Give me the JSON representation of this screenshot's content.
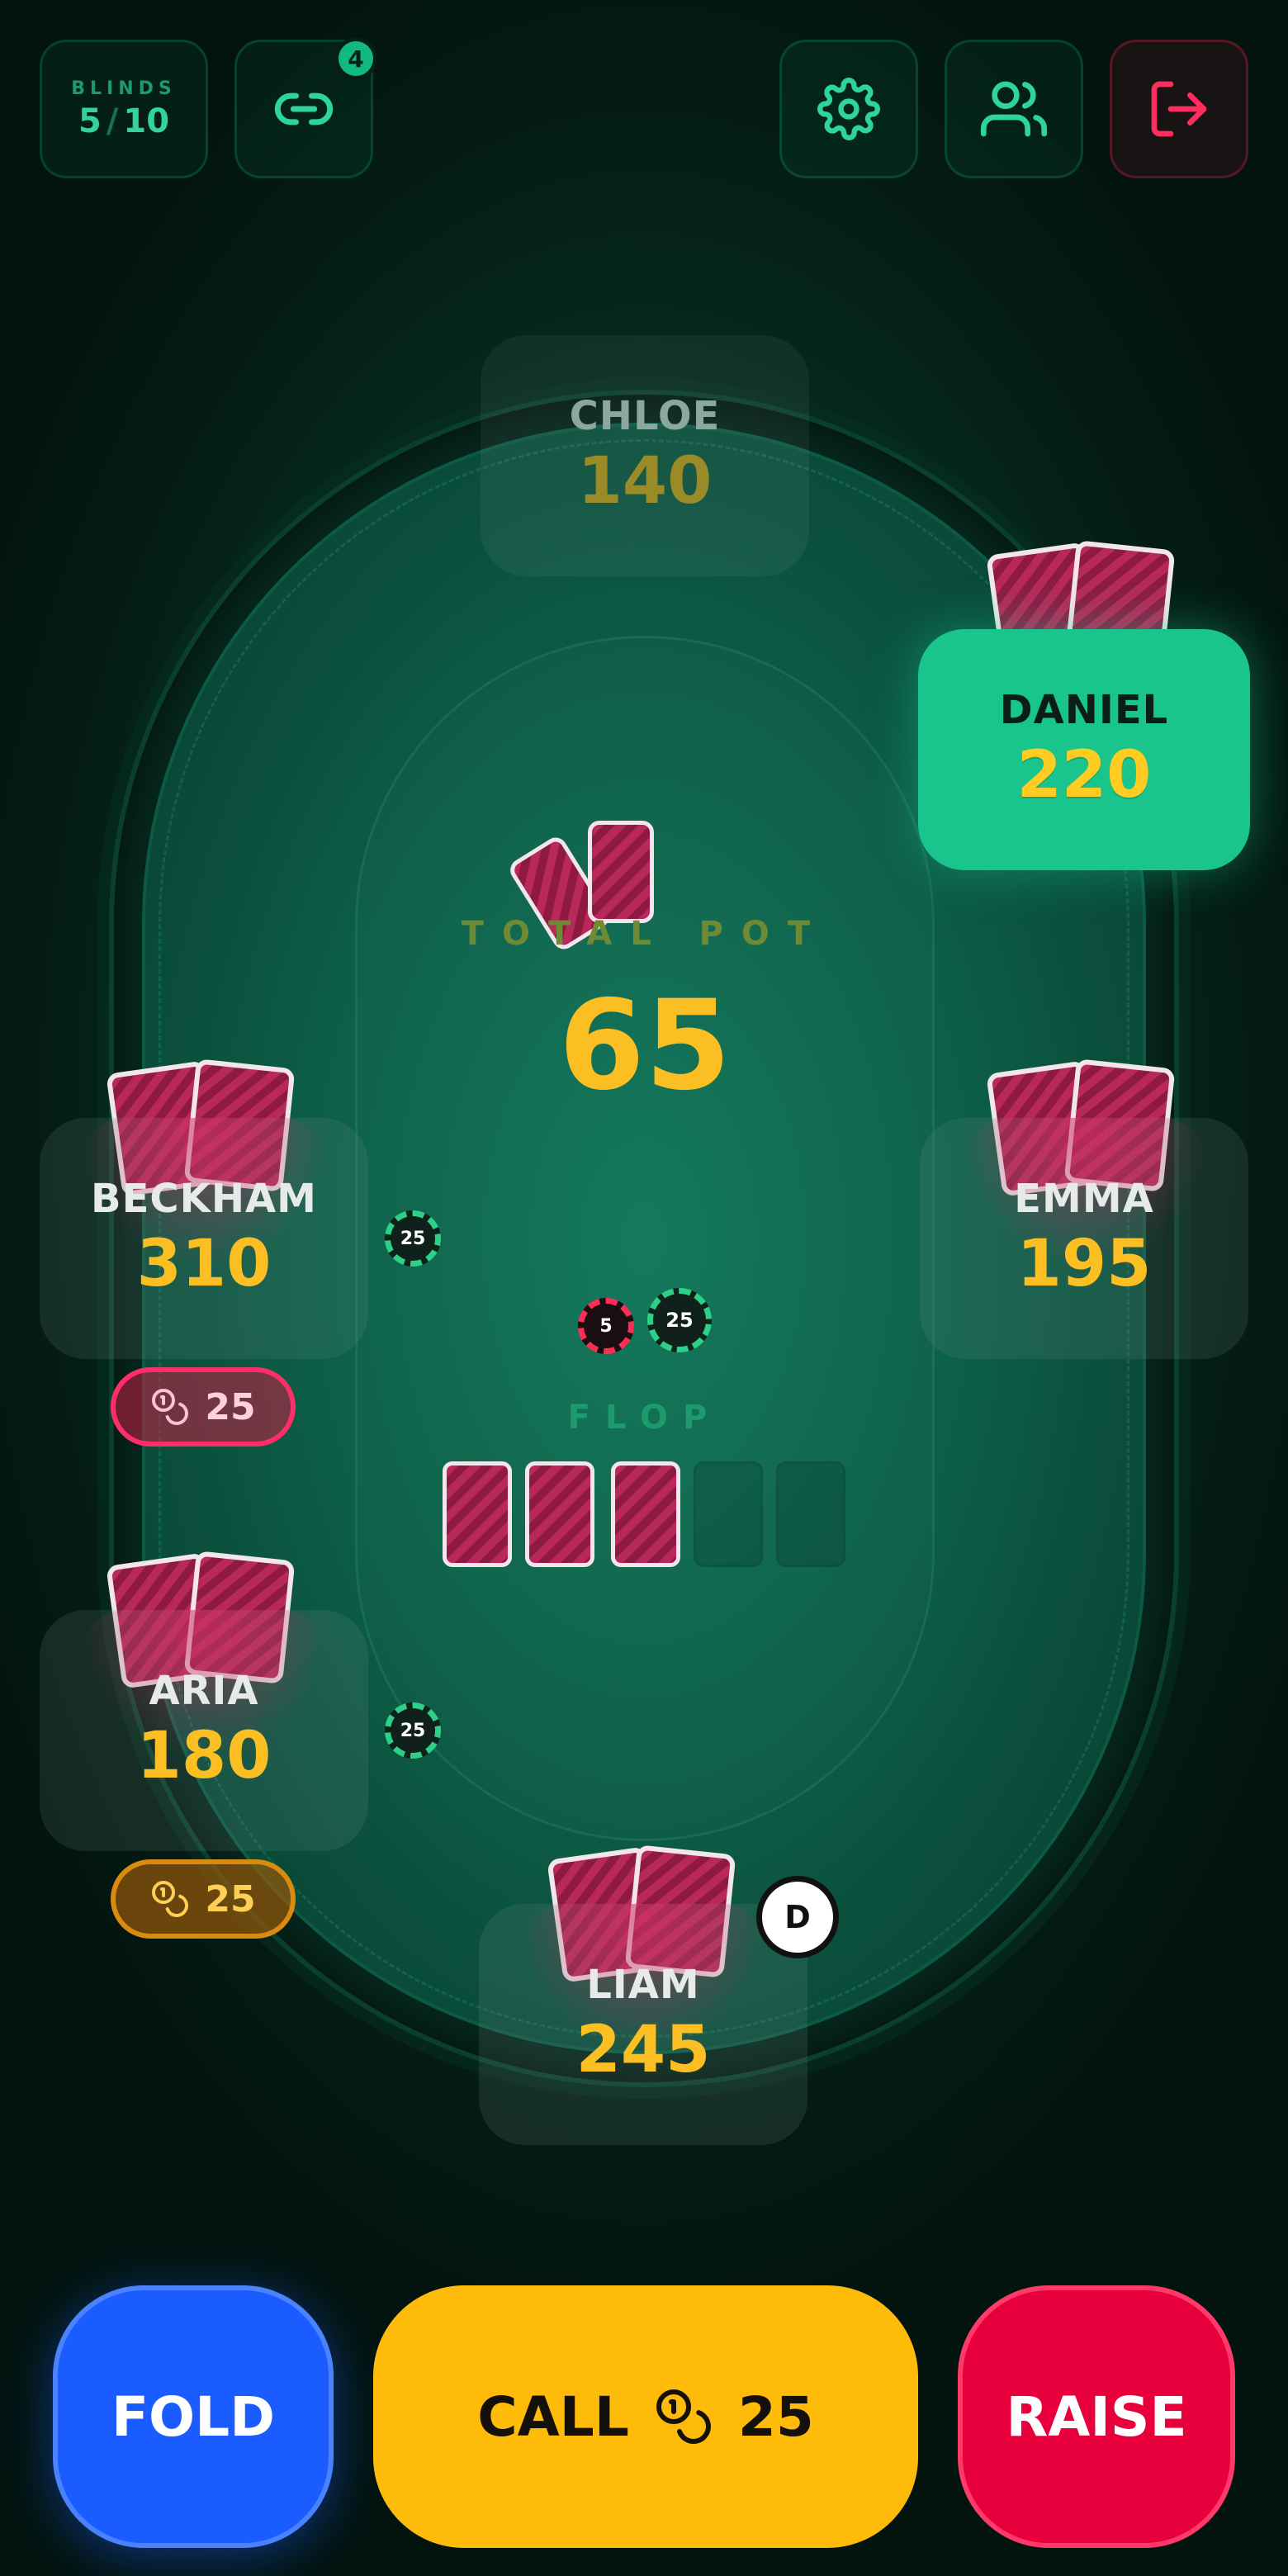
{
  "topbar": {
    "blinds_label": "BLINDS",
    "small_blind": "5",
    "separator": "/",
    "big_blind": "10",
    "invite_badge": "4",
    "icons": {
      "invite": "link-icon",
      "settings": "gear-icon",
      "players": "users-icon",
      "exit": "logout-icon"
    }
  },
  "table": {
    "pot_label": "TOTAL POT",
    "pot_value": "65",
    "street_label": "FLOP",
    "dealer_label": "D",
    "board_cards_revealed": 3,
    "board_slots": 5,
    "pot_chips": [
      "5",
      "25"
    ]
  },
  "players": {
    "chloe": {
      "name": "CHLOE",
      "chips": "140"
    },
    "daniel": {
      "name": "DANIEL",
      "chips": "220"
    },
    "beckham": {
      "name": "BECKHAM",
      "chips": "310",
      "bet": "25",
      "bet_chip": "25"
    },
    "emma": {
      "name": "EMMA",
      "chips": "195"
    },
    "aria": {
      "name": "ARIA",
      "chips": "180",
      "bet": "25",
      "bet_chip": "25"
    },
    "liam": {
      "name": "LIAM",
      "chips": "245"
    }
  },
  "actions": {
    "fold": "FOLD",
    "call": "CALL",
    "call_amount": "25",
    "raise": "RAISE"
  },
  "colors": {
    "accent": "#10b981",
    "gold": "#fbbf24",
    "fold": "#1a5cff",
    "call": "#ffbb0a",
    "raise": "#e8003c"
  }
}
